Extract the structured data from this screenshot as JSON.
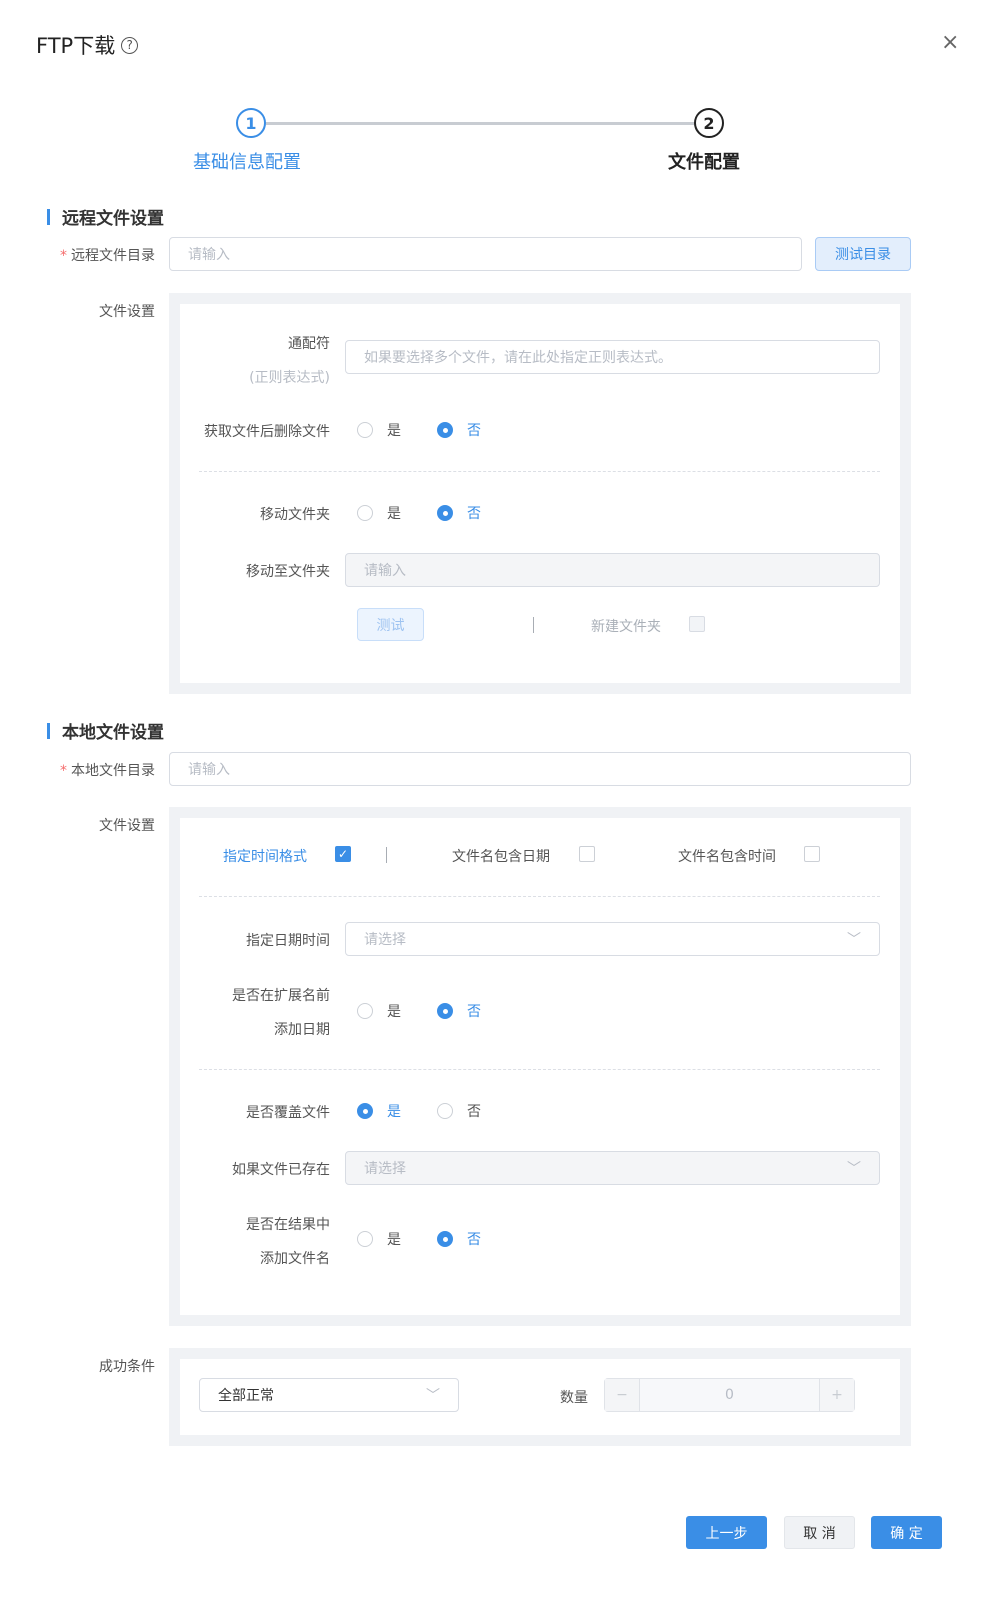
{
  "dialog": {
    "title": "FTP下载",
    "help_icon": "?",
    "close_icon": "×"
  },
  "steps": [
    {
      "number": "1",
      "label": "基础信息配置"
    },
    {
      "number": "2",
      "label": "文件配置"
    }
  ],
  "remote": {
    "section_title": "远程文件设置",
    "dir_label": "远程文件目录",
    "required_mark": "*",
    "dir_placeholder": "请输入",
    "test_dir_button": "测试目录",
    "file_settings_label": "文件设置",
    "wildcard_label": "通配符",
    "wildcard_sub": "(正则表达式)",
    "wildcard_placeholder": "如果要选择多个文件，请在此处指定正则表达式。",
    "delete_after_label": "获取文件后删除文件",
    "yes": "是",
    "no": "否",
    "move_folder_label": "移动文件夹",
    "move_to_label": "移动至文件夹",
    "move_to_placeholder": "请输入",
    "test_button": "测试",
    "new_folder_label": "新建文件夹"
  },
  "local": {
    "section_title": "本地文件设置",
    "dir_label": "本地文件目录",
    "required_mark": "*",
    "dir_placeholder": "请输入",
    "file_settings_label": "文件设置",
    "specify_time_format": "指定时间格式",
    "name_includes_date": "文件名包含日期",
    "name_includes_time": "文件名包含时间",
    "specify_datetime_label": "指定日期时间",
    "select_placeholder": "请选择",
    "before_ext_label_1": "是否在扩展名前",
    "before_ext_label_2": "添加日期",
    "overwrite_label": "是否覆盖文件",
    "if_exists_label": "如果文件已存在",
    "add_filename_label_1": "是否在结果中",
    "add_filename_label_2": "添加文件名",
    "yes": "是",
    "no": "否"
  },
  "success": {
    "label": "成功条件",
    "condition_value": "全部正常",
    "count_label": "数量",
    "minus": "−",
    "count_value": "0",
    "plus": "+"
  },
  "footer": {
    "prev_button": "上一步",
    "cancel_button": "取 消",
    "confirm_button": "确 定"
  },
  "colors": {
    "primary": "#3a8ee6",
    "required": "#f56c6c"
  }
}
